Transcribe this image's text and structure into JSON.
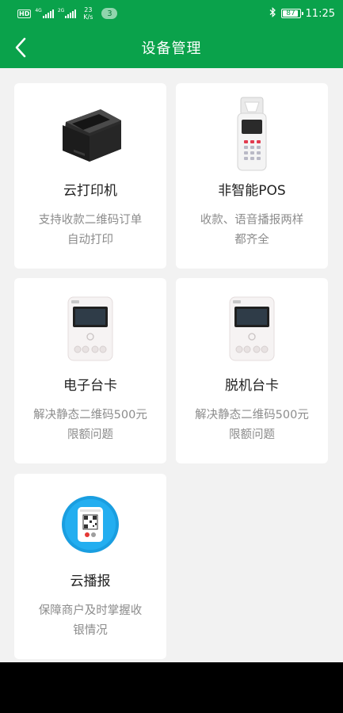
{
  "status_bar": {
    "hd_label": "HD",
    "network_1": "4G",
    "network_2": "2G",
    "speed_value": "23",
    "speed_unit": "K/s",
    "notification_count": "3",
    "battery": "87",
    "time": "11:25"
  },
  "header": {
    "title": "设备管理"
  },
  "devices": [
    {
      "name": "云打印机",
      "description": "支持收款二维码订单自动打印",
      "icon": "thermal-printer-image"
    },
    {
      "name": "非智能POS",
      "description": "收款、语音播报两样都齐全",
      "icon": "pos-terminal-image"
    },
    {
      "name": "电子台卡",
      "description": "解决静态二维码500元限额问题",
      "icon": "electronic-card-device-image"
    },
    {
      "name": "脱机台卡",
      "description": "解决静态二维码500元限额问题",
      "icon": "offline-card-device-image"
    },
    {
      "name": "云播报",
      "description": "保障商户及时掌握收银情况",
      "icon": "cloud-speaker-image"
    }
  ],
  "colors": {
    "brand_green": "#0aa24b",
    "background": "#f2f2f2",
    "card": "#ffffff",
    "title_text": "#222222",
    "desc_text": "#8c8c8c"
  }
}
